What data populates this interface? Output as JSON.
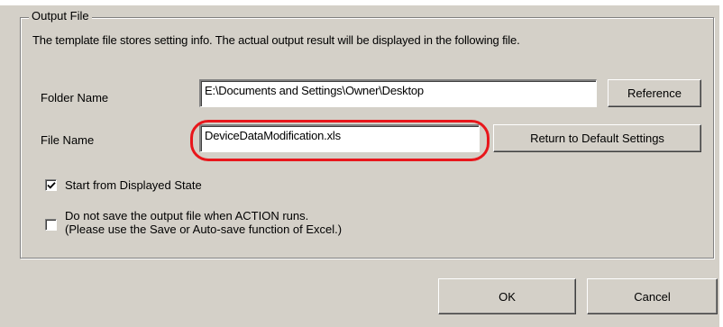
{
  "group": {
    "title": "Output File",
    "description": "The template file stores setting info. The actual output result will be displayed in the following file."
  },
  "folder": {
    "label": "Folder Name",
    "value": "E:\\Documents and Settings\\Owner\\Desktop",
    "reference_button": "Reference"
  },
  "file": {
    "label": "File Name",
    "value": "DeviceDataModification.xls",
    "default_button": "Return to Default Settings"
  },
  "options": {
    "start_displayed": {
      "label": "Start from Displayed State",
      "checked": true
    },
    "no_save": {
      "line1": "Do not save the output file when ACTION runs.",
      "line2": "(Please use the Save or Auto-save function of Excel.)",
      "checked": false
    }
  },
  "footer": {
    "ok": "OK",
    "cancel": "Cancel"
  },
  "colors": {
    "dialog_bg": "#d4d0c8",
    "highlight": "#e8161b"
  }
}
